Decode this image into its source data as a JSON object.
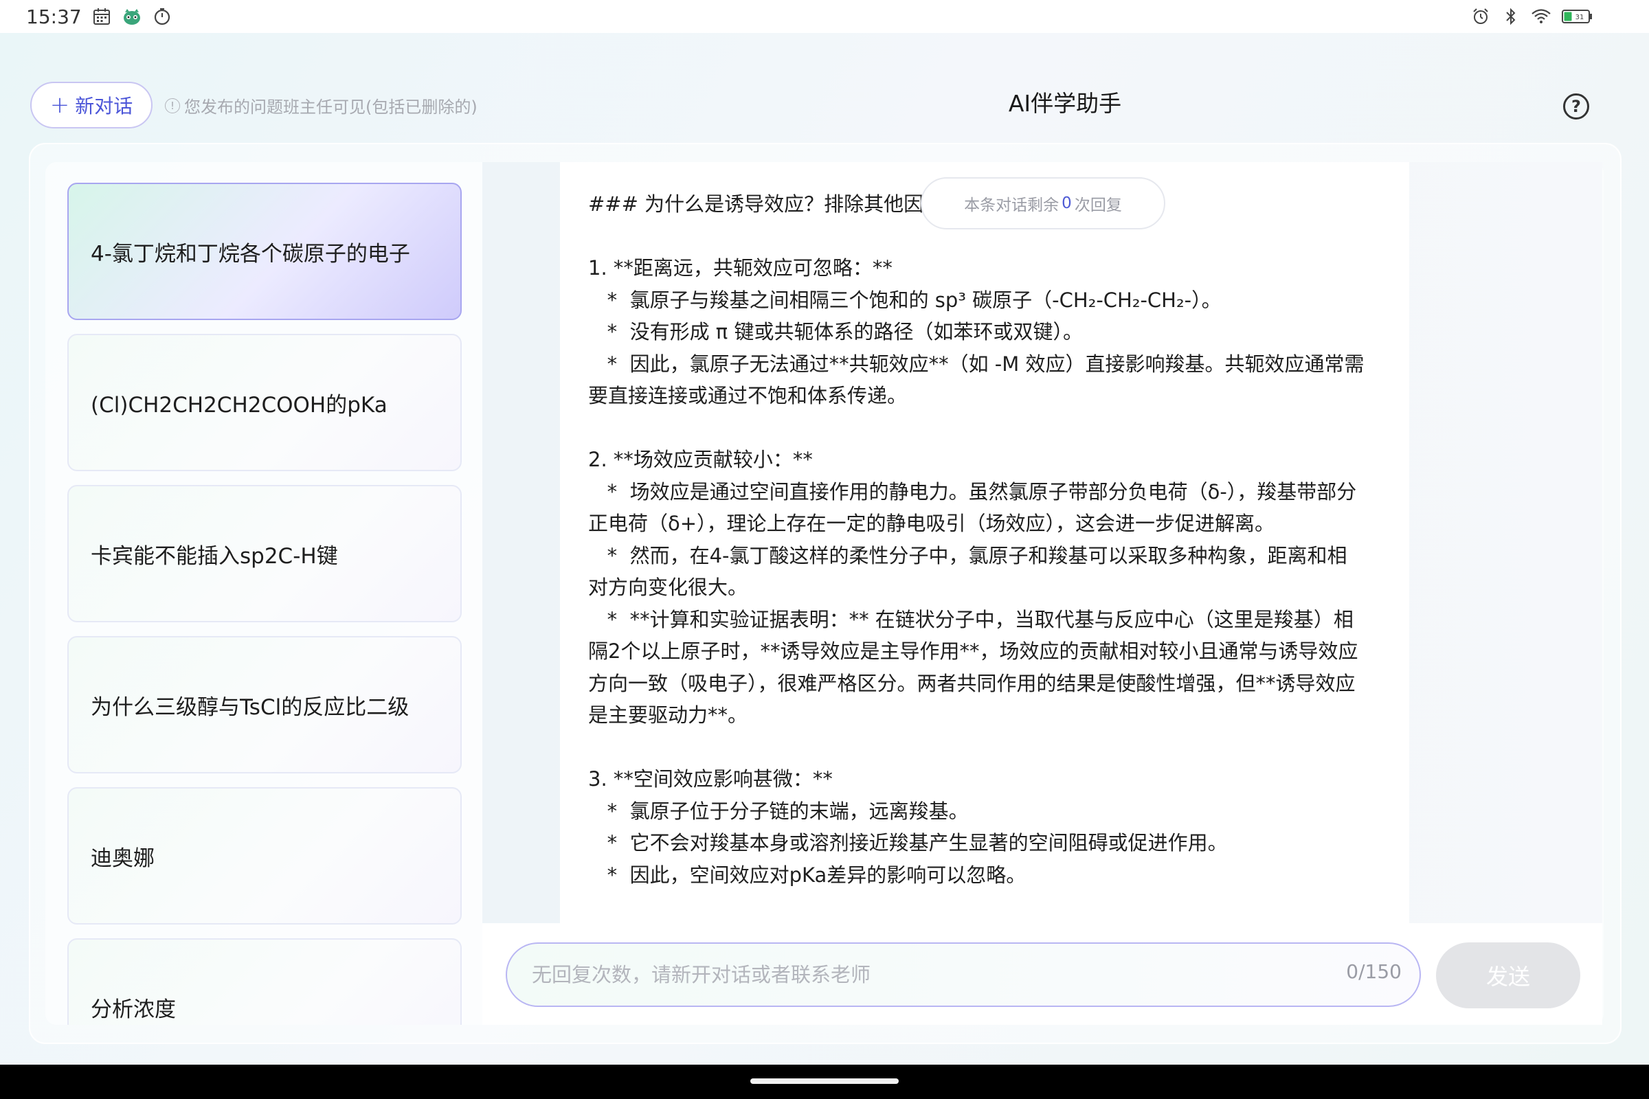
{
  "status_bar": {
    "time": "15:37",
    "left_icons": [
      "calendar-icon",
      "app-mascot-icon",
      "timer-icon"
    ],
    "right_icons": [
      "alarm-icon",
      "bluetooth-icon",
      "wifi-icon",
      "battery-icon"
    ],
    "battery": "31"
  },
  "header": {
    "new_chat_label": "新对话",
    "notice": "您发布的问题班主任可见(包括已删除的)",
    "title": "AI伴学助手",
    "help_label": "?"
  },
  "sidebar": {
    "items": [
      {
        "label": "4-氯丁烷和丁烷各个碳原子的电子",
        "active": true
      },
      {
        "label": "(Cl)CH2CH2CH2COOH的pKa",
        "active": false
      },
      {
        "label": "卡宾能不能插入sp2C-H键",
        "active": false
      },
      {
        "label": "为什么三级醇与TsCl的反应比二级",
        "active": false
      },
      {
        "label": "迪奥娜",
        "active": false
      },
      {
        "label": "分析浓度",
        "active": false
      }
    ]
  },
  "chat": {
    "remaining_prefix": "本条对话剩余",
    "remaining_count": "0",
    "remaining_suffix": "次回复",
    "message_lines": [
      "### 为什么是诱导效应？排除其他因素",
      "",
      "1. **距离远，共轭效应可忽略：**",
      "   *  氯原子与羧基之间相隔三个饱和的 sp³ 碳原子（-CH₂-CH₂-CH₂-）。",
      "   *  没有形成 π 键或共轭体系的路径（如苯环或双键）。",
      "   *  因此，氯原子无法通过**共轭效应**（如 -M 效应）直接影响羧基。共轭效应通常需",
      "要直接连接或通过不饱和体系传递。",
      "",
      "2. **场效应贡献较小：**",
      "   *  场效应是通过空间直接作用的静电力。虽然氯原子带部分负电荷（δ-），羧基带部分",
      "正电荷（δ+），理论上存在一定的静电吸引（场效应），这会进一步促进解离。",
      "   *  然而，在4-氯丁酸这样的柔性分子中，氯原子和羧基可以采取多种构象，距离和相",
      "对方向变化很大。",
      "   *  **计算和实验证据表明：** 在链状分子中，当取代基与反应中心（这里是羧基）相",
      "隔2个以上原子时，**诱导效应是主导作用**，场效应的贡献相对较小且通常与诱导效应",
      "方向一致（吸电子），很难严格区分。两者共同作用的结果是使酸性增强，但**诱导效应",
      "是主要驱动力**。",
      "",
      "3. **空间效应影响甚微：**",
      "   *  氯原子位于分子链的末端，远离羧基。",
      "   *  它不会对羧基本身或溶剂接近羧基产生显著的空间阻碍或促进作用。",
      "   *  因此，空间效应对pKa差异的影响可以忽略。"
    ]
  },
  "input": {
    "placeholder": "无回复次数，请新开对话或者联系老师",
    "char_count": "0/150",
    "send_label": "发送"
  },
  "colors": {
    "accent": "#4b55d8",
    "active_item_border": "#a8a6f0",
    "send_disabled": "#e3e4e7"
  }
}
